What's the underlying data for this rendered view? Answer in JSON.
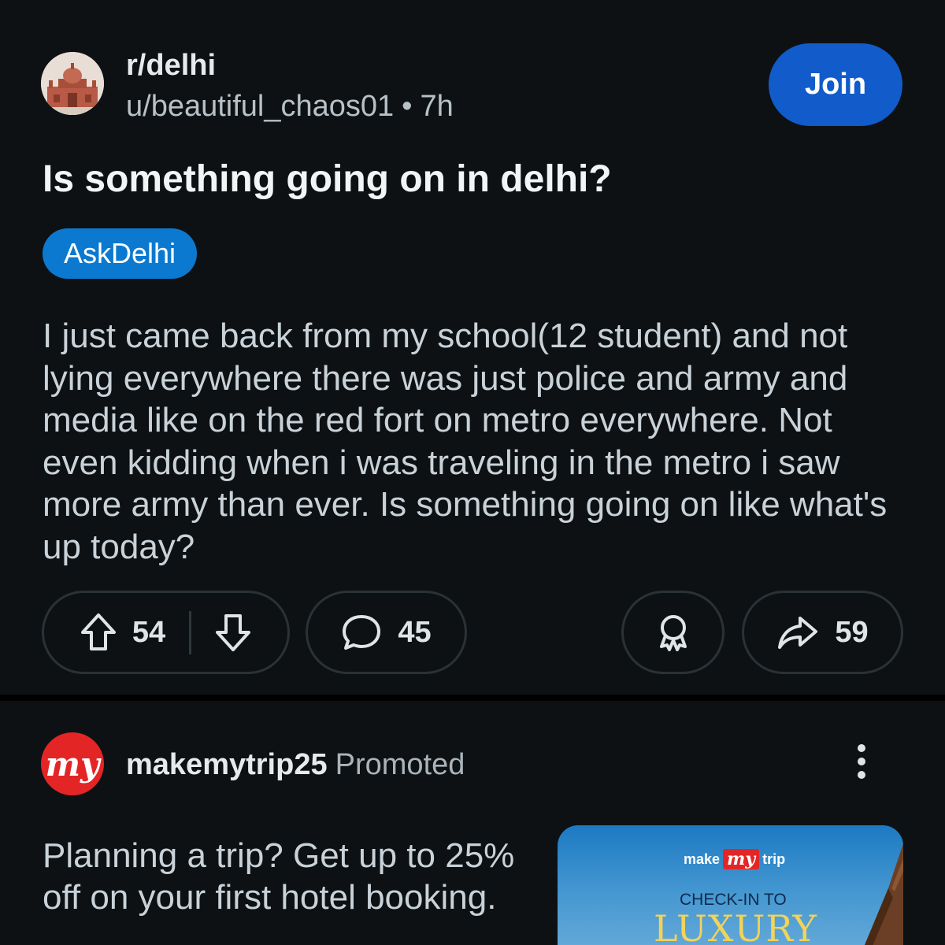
{
  "post": {
    "subreddit": "r/delhi",
    "author": "u/beautiful_chaos01",
    "separator": "•",
    "time": "7h",
    "join_label": "Join",
    "title": "Is something going on in delhi?",
    "flair": "AskDelhi",
    "body": "I just came back from my school(12 student) and not lying everywhere there was just police and army and media like on the red fort on metro everywhere. Not even kidding when i was traveling in the metro i saw more army than ever. Is something going on like what's up today?",
    "upvotes": "54",
    "comments": "45",
    "shares": "59",
    "icons": [
      "upvote-icon",
      "downvote-icon",
      "comment-icon",
      "award-icon",
      "share-icon"
    ]
  },
  "ad": {
    "avatar_text": "my",
    "advertiser": "makemytrip25",
    "promoted_label": "Promoted",
    "text": "Planning a trip? Get up to 25% off on your first hotel booking.",
    "banner": {
      "logo_make": "make",
      "logo_my": "my",
      "logo_trip": "trip",
      "tagline": "CHECK-IN TO",
      "headline": "LUXURY"
    },
    "icons": [
      "more-options-icon"
    ]
  },
  "colors": {
    "background": "#0e1113",
    "join_button": "#115bca",
    "flair": "#0b79d0",
    "brand_red": "#e42526"
  }
}
